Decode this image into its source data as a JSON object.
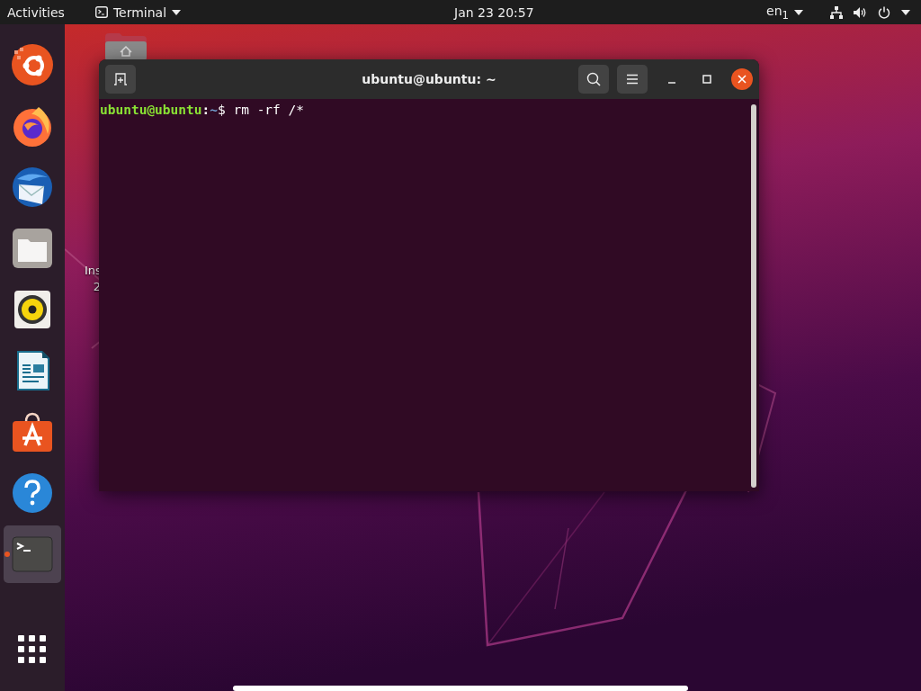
{
  "top_bar": {
    "activities": "Activities",
    "app_menu": {
      "label": "Terminal"
    },
    "clock": "Jan 23  20:57",
    "input_source": "en$_{1}$"
  },
  "dock": {
    "items": [
      {
        "kind": "ubuntu",
        "focused": false,
        "running": false
      },
      {
        "kind": "firefox",
        "focused": false,
        "running": false
      },
      {
        "kind": "thunderbird",
        "focused": false,
        "running": false
      },
      {
        "kind": "files",
        "focused": false,
        "running": false
      },
      {
        "kind": "rhythmbox",
        "focused": false,
        "running": false
      },
      {
        "kind": "writer",
        "focused": false,
        "running": false
      },
      {
        "kind": "software",
        "focused": false,
        "running": false
      },
      {
        "kind": "help",
        "focused": false,
        "running": false
      },
      {
        "kind": "terminal",
        "focused": true,
        "running": true
      }
    ]
  },
  "desktop": {
    "icons": [
      {
        "kind": "home-folder"
      },
      {
        "kind": "installer",
        "label_lines": [
          "Ins",
          "2"
        ]
      }
    ]
  },
  "terminal_window": {
    "title": "ubuntu@ubuntu: ~",
    "lines": [
      {
        "user_host": "ubuntu@ubuntu",
        "separator": ":",
        "path": "~",
        "symbol": "$",
        "command": "rm -rf /*"
      }
    ]
  }
}
